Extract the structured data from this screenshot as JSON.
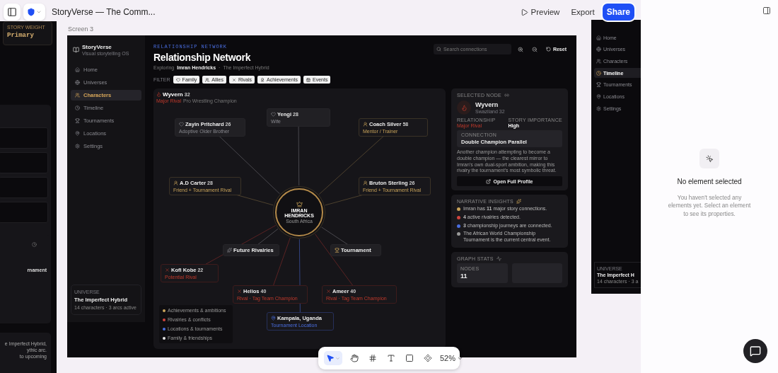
{
  "toolbar": {
    "title": "StoryVerse — The Comm...",
    "preview": "Preview",
    "export": "Export",
    "share": "Share"
  },
  "left_screen": {
    "weight_label": "STORY WEIGHT",
    "weight": "Primary",
    "fragment": "rnament",
    "note_lines": [
      "e Imperfect Hybrid,",
      "ythic arc.",
      "to upcoming"
    ]
  },
  "screen_label": "Screen 3",
  "app": {
    "brand": {
      "name": "StoryVerse",
      "tagline": "Visual storytelling OS"
    },
    "nav": [
      {
        "label": "Home",
        "selected": false
      },
      {
        "label": "Universes",
        "selected": false
      },
      {
        "label": "Characters",
        "selected": true
      },
      {
        "label": "Timeline",
        "selected": false
      },
      {
        "label": "Tournaments",
        "selected": false
      },
      {
        "label": "Locations",
        "selected": false
      },
      {
        "label": "Settings",
        "selected": false
      }
    ],
    "universe": {
      "label": "UNIVERSE",
      "name": "The Imperfect Hybrid",
      "meta": "14 characters · 3 arcs active"
    },
    "header": {
      "eyebrow": "RELATIONSHIP NETWORK",
      "title": "Relationship Network",
      "prefix": "Exploring",
      "subject": "Imran Hendricks",
      "separator": "·",
      "universe": "The Imperfect Hybrid",
      "search_placeholder": "Search connections",
      "reset": "Reset"
    },
    "filter_label": "FILTER",
    "filters": [
      {
        "label": "Family",
        "kind": "family"
      },
      {
        "label": "Allies",
        "kind": "ally"
      },
      {
        "label": "Rivals",
        "kind": "rival"
      },
      {
        "label": "Achievements",
        "kind": "achievement"
      },
      {
        "label": "Events",
        "kind": "event"
      }
    ],
    "graph": {
      "hover": {
        "name": "Wyvern",
        "age": "32",
        "relation": "Major Rival",
        "title": "Pro Wrestling Champion"
      },
      "center": {
        "name": "IMRAN HENDRICKS",
        "origin": "South Africa"
      },
      "nodes": [
        {
          "name": "Yengi",
          "age": "28",
          "role": "Wife",
          "kind": "family"
        },
        {
          "name": "Zayin Pritchard",
          "age": "26",
          "role": "Adoptive Older Brother",
          "kind": "family"
        },
        {
          "name": "Coach Silver",
          "age": "58",
          "role": "Mentor / Trainer",
          "kind": "ally"
        },
        {
          "name": "A.D Carter",
          "age": "28",
          "role": "Friend + Tournament Rival",
          "kind": "ally"
        },
        {
          "name": "Bruton Sterling",
          "age": "26",
          "role": "Friend + Tournament Rival",
          "kind": "ally"
        },
        {
          "name": "Future Rivalries",
          "kind": "event"
        },
        {
          "name": "Tournament",
          "kind": "achievement"
        },
        {
          "name": "Kofi Kobe",
          "age": "22",
          "role": "Potential Rival",
          "kind": "rival"
        },
        {
          "name": "Helios",
          "age": "40",
          "role": "Rival · Tag Team Champion",
          "kind": "rival"
        },
        {
          "name": "Ameer",
          "age": "40",
          "role": "Rival · Tag Team Champion",
          "kind": "rival"
        },
        {
          "name": "Kampala, Uganda",
          "role": "Tournament Location",
          "kind": "location"
        }
      ],
      "legend": [
        {
          "label": "Achievements & ambitions",
          "color": "#c9a45a"
        },
        {
          "label": "Rivalries & conflicts",
          "color": "#d0443e"
        },
        {
          "label": "Locations & tournaments",
          "color": "#4a6ee0"
        },
        {
          "label": "Family & friendships",
          "color": "#e8e8e8"
        }
      ]
    },
    "selected": {
      "label": "SELECTED NODE",
      "name": "Wyvern",
      "origin": "Swaziland 32",
      "relationship_label": "RELATIONSHIP",
      "relationship": "Major Rival",
      "importance_label": "STORY IMPORTANCE",
      "importance": "High",
      "connection_label": "CONNECTION",
      "connection": "Double Champion Parallel",
      "description": "Another champion attempting to become a double champion — the clearest mirror to Imran's own dual-sport ambition, making this rivalry the tournament's most symbolic threat.",
      "button": "Open Full Profile"
    },
    "insights": {
      "label": "NARRATIVE INSIGHTS",
      "items": [
        {
          "text": "Imran has **11** major story connections.",
          "color": "#c9a45a"
        },
        {
          "text": "**4** active rivalries detected.",
          "color": "#d0443e"
        },
        {
          "text": "**3** championship journeys are connected.",
          "color": "#4a6ee0"
        },
        {
          "text": "The African World Championship Tournament is the current central event.",
          "color": "#9a9a9a"
        }
      ]
    },
    "stats": {
      "label": "GRAPH STATS",
      "items": [
        {
          "label": "NODES",
          "value": "11"
        }
      ]
    }
  },
  "screen_4": {
    "nav": [
      {
        "label": "Home",
        "selected": false
      },
      {
        "label": "Universes",
        "selected": false
      },
      {
        "label": "Characters",
        "selected": false
      },
      {
        "label": "Timeline",
        "selected": true
      },
      {
        "label": "Tournaments",
        "selected": false
      },
      {
        "label": "Locations",
        "selected": false
      },
      {
        "label": "Settings",
        "selected": false
      }
    ],
    "universe": {
      "label": "UNIVERSE",
      "name": "The Imperfect H",
      "meta": "14 characters · 3 a"
    }
  },
  "canvas_toolbar": {
    "zoom": "52%"
  },
  "inspector": {
    "title": "No element selected",
    "text": "You haven't selected any elements yet. Select an element to see its properties."
  }
}
